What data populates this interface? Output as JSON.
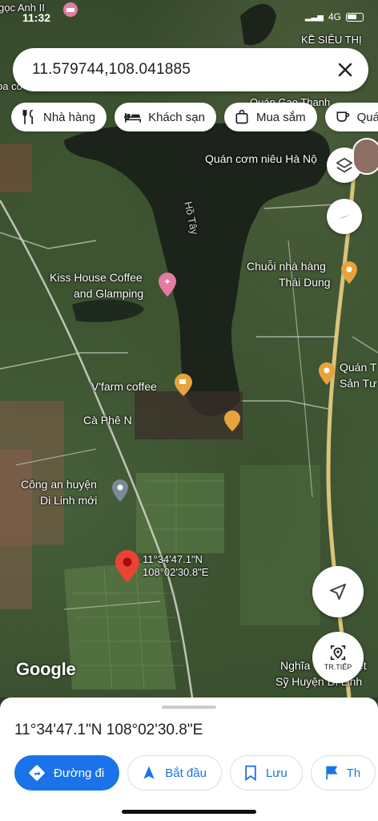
{
  "status": {
    "time": "11:32",
    "network": "4G"
  },
  "search": {
    "value": "11.579744,108.041885"
  },
  "chips": [
    {
      "label": "Nhà hàng",
      "icon": "restaurant-icon"
    },
    {
      "label": "Khách sạn",
      "icon": "hotel-icon"
    },
    {
      "label": "Mua sắm",
      "icon": "shopping-bag-icon"
    },
    {
      "label": "Quá",
      "icon": "cafe-icon"
    }
  ],
  "map": {
    "lake": "Hồ Tây",
    "labels": {
      "top_left": "gọc Anh II",
      "top_right": "KỀ SIÊU THỊ",
      "quan_com": "Quán cơm niêu Hà Nộ",
      "quan_gan": "Quán Gạo Thanh",
      "kiss1": "Kiss House Coffee",
      "kiss2": "and Glamping",
      "chuoi1": "Chuỗi nhà hàng",
      "chuoi2": "Thái Dung",
      "vfarm": "V'farm coffee",
      "caphe": "Cà Phê N",
      "quan1": "Quán T",
      "quan2": "Sản Tư",
      "congan1": "Công an huyện",
      "congan2": "Di Linh mới",
      "nghia1": "Nghĩa",
      "nghia2": "ệt",
      "sy": "Sỹ Huyện Di Linh",
      "left_edge": "oa cơ"
    },
    "pin_lat": "11°34'47.1\"N",
    "pin_lng": "108°02'30.8\"E",
    "google": "Google",
    "traffic_label": "TR.TIẾP"
  },
  "sheet": {
    "coords": "11°34'47.1\"N 108°02'30.8\"E",
    "actions": [
      {
        "label": "Đường đi",
        "icon": "directions-icon"
      },
      {
        "label": "Bắt đầu",
        "icon": "navigation-icon"
      },
      {
        "label": "Lưu",
        "icon": "bookmark-icon"
      },
      {
        "label": "Th",
        "icon": "flag-icon"
      }
    ]
  },
  "colors": {
    "accent": "#1a73e8",
    "pin": "#ea4335",
    "poi_orange": "#e8a33c",
    "poi_pink": "#e37ba2"
  }
}
